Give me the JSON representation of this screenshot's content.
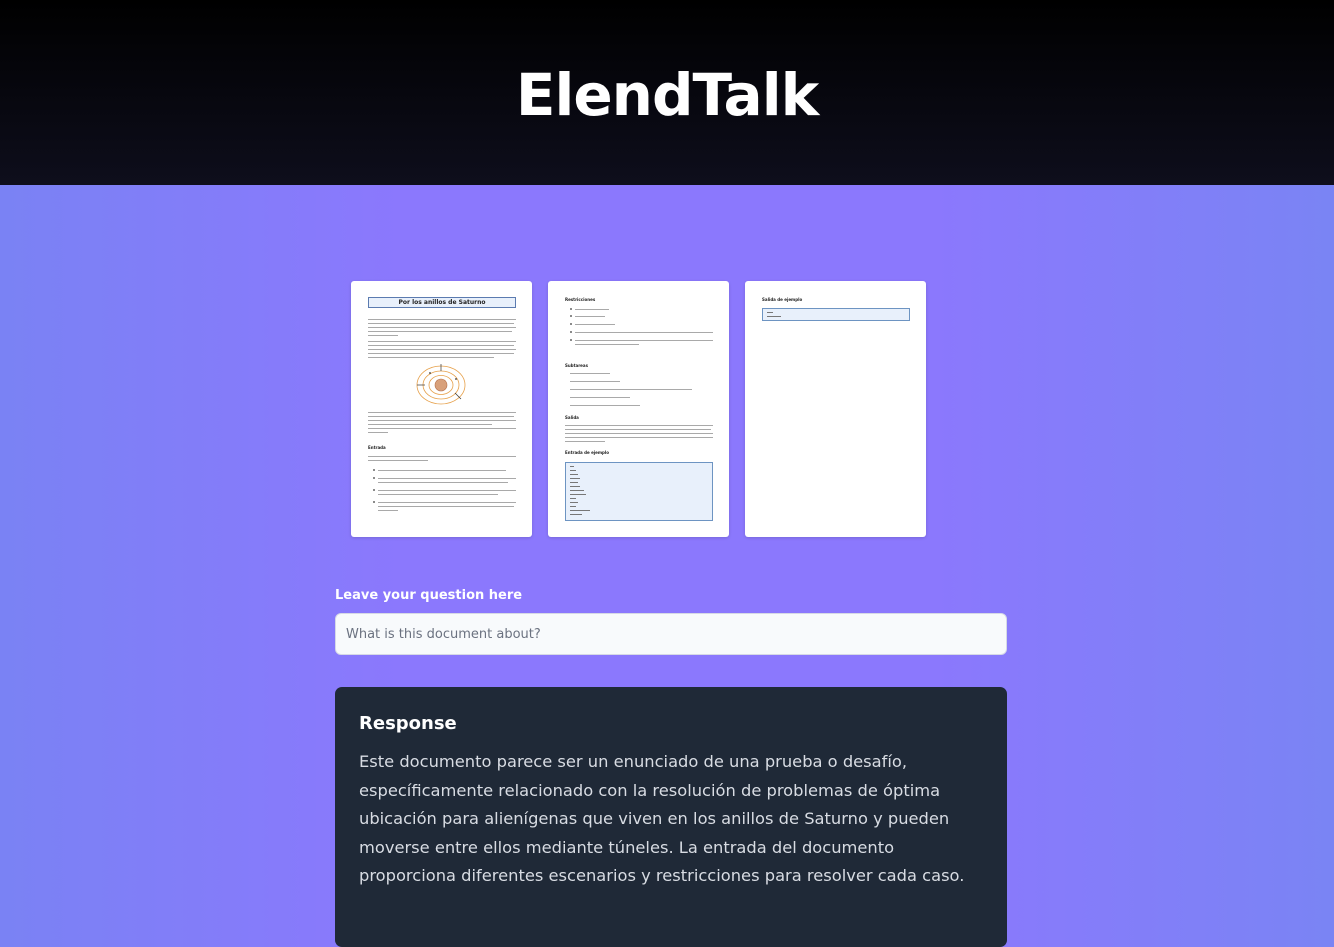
{
  "header": {
    "brand": "ElendTalk"
  },
  "document": {
    "pages": [
      {
        "title": "Por los anillos de Saturno",
        "sections": [
          "Entrada"
        ]
      },
      {
        "sections": [
          "Restricciones",
          "Subtareas",
          "Salida",
          "Entrada de ejemplo"
        ]
      },
      {
        "sections": [
          "Salida de ejemplo"
        ]
      }
    ]
  },
  "question": {
    "label": "Leave your question here",
    "placeholder": "What is this document about?",
    "value": ""
  },
  "response": {
    "title": "Response",
    "text": "Este documento parece ser un enunciado de una prueba o desafío, específicamente relacionado con la resolución de problemas de óptima ubicación para alienígenas que viven en los anillos de Saturno y pueden mo­verse entre ellos mediante túneles. La entrada del documento proporciona diferentes escenarios y restricciones para resolver cada caso."
  }
}
